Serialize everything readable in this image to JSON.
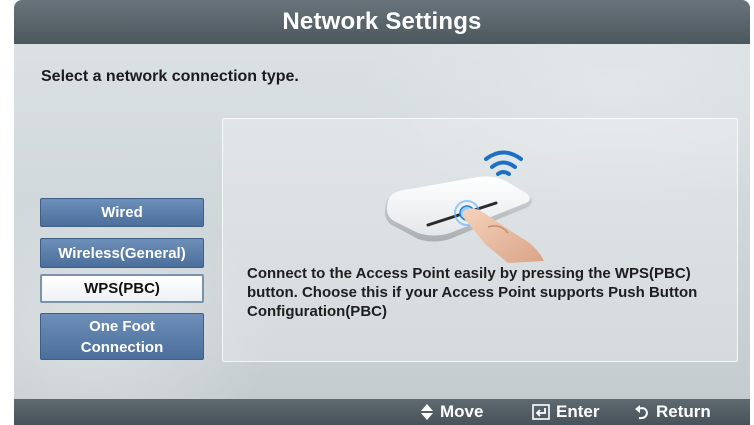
{
  "title": "Network Settings",
  "prompt": "Select a network connection type.",
  "options": [
    {
      "label": "Wired"
    },
    {
      "label": "Wireless(General)"
    },
    {
      "label": "WPS(PBC)",
      "selected": true
    },
    {
      "label": "One Foot\nConnection"
    }
  ],
  "description": "Connect to the Access Point easily by pressing the WPS(PBC) button. Choose this if your Access Point supports Push Button Configuration(PBC)",
  "footer": {
    "move": {
      "label": "Move",
      "icon": "up-down-arrow-icon"
    },
    "enter": {
      "label": "Enter",
      "icon": "enter-icon"
    },
    "return": {
      "label": "Return",
      "icon": "return-icon"
    }
  },
  "colors": {
    "title_bar": "#56616a",
    "option_button": "#5a7ca8",
    "option_selected": "#ffffff",
    "footer_bar": "#505a61"
  }
}
